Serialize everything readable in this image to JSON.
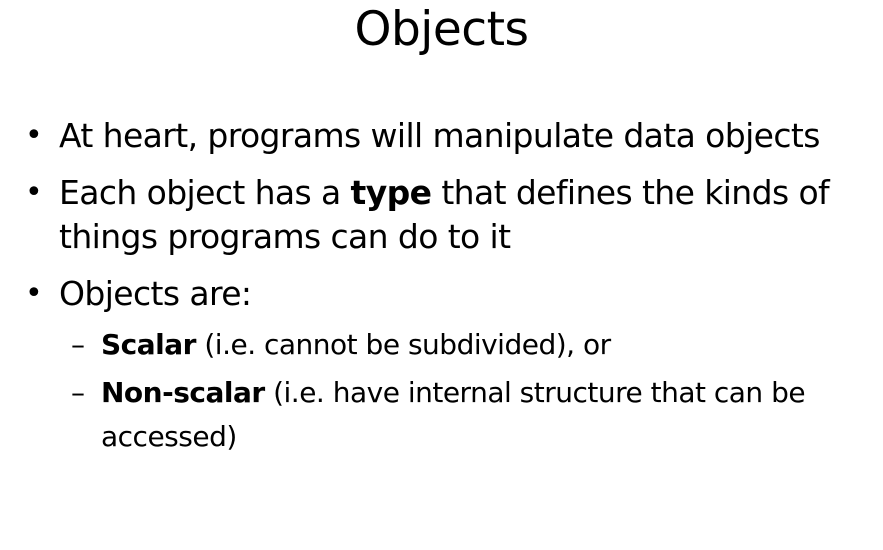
{
  "slide": {
    "title": "Objects",
    "bullets": [
      {
        "text": "At heart, programs will manipulate data objects"
      },
      {
        "pre": "Each object has a ",
        "bold": "type",
        "post": " that defines the kinds of things programs can do to it"
      },
      {
        "text": "Objects are:"
      }
    ],
    "subbullets": [
      {
        "bold": "Scalar",
        "post": " (i.e. cannot be subdivided), or"
      },
      {
        "bold": "Non-scalar",
        "post": " (i.e. have internal structure that can be accessed)"
      }
    ],
    "bullet_symbol": "•",
    "dash_symbol": "–"
  }
}
